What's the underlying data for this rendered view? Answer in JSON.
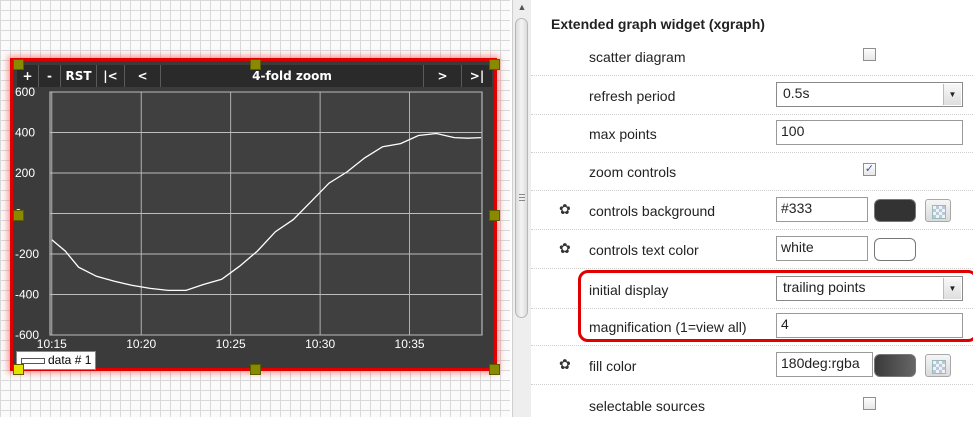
{
  "widget": {
    "controls": {
      "plus": "+",
      "minus": "-",
      "reset": "RST",
      "first": "|<",
      "prev": "<",
      "zoom_label": "4-fold zoom",
      "next": ">",
      "last": ">|"
    },
    "legend": {
      "label": "data # 1"
    }
  },
  "chart_data": {
    "type": "line",
    "x_ticks": [
      "10:15",
      "10:20",
      "10:25",
      "10:30",
      "10:35"
    ],
    "y_ticks": [
      "600",
      "400",
      "200",
      "0",
      "-200",
      "-400",
      "-600"
    ],
    "ylim": [
      -600,
      600
    ],
    "grid": true,
    "series": [
      {
        "name": "data # 1",
        "x": [
          "10:15:00",
          "10:15:45",
          "10:16:30",
          "10:17:30",
          "10:18:30",
          "10:19:30",
          "10:20:30",
          "10:21:30",
          "10:22:30",
          "10:23:30",
          "10:24:30",
          "10:25:30",
          "10:26:30",
          "10:27:30",
          "10:28:30",
          "10:29:30",
          "10:30:30",
          "10:31:30",
          "10:32:30",
          "10:33:30",
          "10:34:30",
          "10:35:30",
          "10:36:30",
          "10:37:30",
          "10:38:15",
          "10:39:00"
        ],
        "y": [
          -130,
          -185,
          -265,
          -310,
          -335,
          -355,
          -370,
          -380,
          -380,
          -350,
          -325,
          -260,
          -185,
          -90,
          -30,
          60,
          150,
          205,
          275,
          330,
          345,
          385,
          395,
          375,
          372,
          375
        ]
      }
    ],
    "colors": {
      "background": "#3b3b3b",
      "grid": "#bdbdbd",
      "line": "#ffffff",
      "text": "#ffffff"
    }
  },
  "scrollbar": {
    "up_arrow": "▲"
  },
  "panel": {
    "title": "Extended graph widget (xgraph)",
    "rows": [
      {
        "label": "scatter diagram",
        "checked": false
      },
      {
        "label": "refresh period",
        "value": "0.5s"
      },
      {
        "label": "max points",
        "value": "100"
      },
      {
        "label": "zoom controls",
        "checked": true,
        "check_glyph": "✓"
      },
      {
        "label": "controls background",
        "value": "#333",
        "swatch": "#333333"
      },
      {
        "label": "controls text color",
        "value": "white",
        "swatch": "#ffffff"
      },
      {
        "label": "initial display",
        "value": "trailing points"
      },
      {
        "label": "magnification (1=view all)",
        "value": "4"
      },
      {
        "label": "fill color",
        "value": "180deg:rgba",
        "swatch": "#555555"
      },
      {
        "label": "selectable sources",
        "checked": false
      }
    ],
    "gear_glyph": "✿",
    "dropdown_glyph": "▼",
    "highlight_color": "#e00000"
  }
}
